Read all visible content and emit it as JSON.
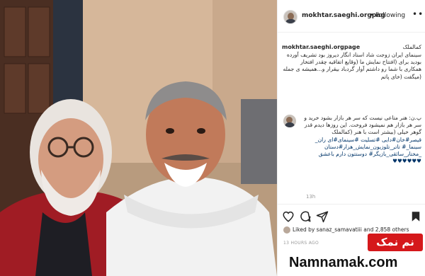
{
  "post": {
    "username": "mokhtar.saeghi.orgpag",
    "follow_separator": "•",
    "follow_label": "Following",
    "more_glyph": "•••",
    "caption": {
      "username": "mokhtar.saeghi.orgpage",
      "first_line": "کمالملک",
      "body": "سینمای ایران زوجت شاد استاد انگار دیروز بود تشریف آورده بودید برای (افتتاح نمایش ما (وقایع اتفاقیه چقدر افتخار همکاری با شما رو داشتم آوار گردباد بیقرار و...همیشه ی جمله (میگفت (خای پاتم"
    },
    "comment": {
      "body": "پ.ن: هنر متاعی نیست که سر هر بازار بشود خرید و سر هر بازار هم نمیشود فروخت. این روزها دیدم قدر گوهر خیلی (بیشتر است با هنر (کمالملک",
      "tags": "قیصر#خان#دایی #تسلیت #سینمای#ای ران_ سینما_# تاتر_تلوزیون_نمایش_هزار#دستان _مختار_سائقی_بازیگر# دوستتون دارم باعشق ♥♥♥♥♥♥"
    },
    "time": "13h",
    "liked_by": "Liked by sanaz_samavatiii and 2,858 others",
    "ago": "13 HOURS AGO"
  },
  "watermark": {
    "logo_text": "نم نمک",
    "site": "Namnamak.com"
  },
  "colors": {
    "logo_red": "#d5181b",
    "link_blue": "#003569"
  },
  "icons": [
    "heart-icon",
    "comment-icon",
    "share-icon",
    "bookmark-icon"
  ]
}
